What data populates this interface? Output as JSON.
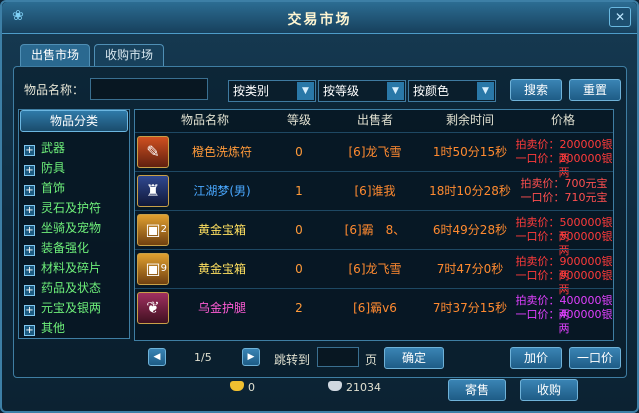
{
  "window": {
    "title": "交易市场"
  },
  "tabs": [
    {
      "label": "出售市场",
      "active": true
    },
    {
      "label": "收购市场",
      "active": false
    }
  ],
  "search": {
    "name_label": "物品名称：",
    "name_value": "",
    "type_select": "按类别",
    "level_select": "按等级",
    "color_select": "按颜色",
    "search_button": "搜索",
    "reset_button": "重置"
  },
  "categories": {
    "header": "物品分类",
    "items": [
      "武器",
      "防具",
      "首饰",
      "灵石及护符",
      "坐骑及宠物",
      "装备强化",
      "材料及碎片",
      "药品及状态",
      "元宝及银两",
      "其他"
    ]
  },
  "table": {
    "headers": [
      "物品名称",
      "等级",
      "出售者",
      "剩余时间",
      "价格"
    ],
    "rows": [
      {
        "icon": "scroll-icon",
        "name": "橙色洗炼符",
        "name_color": "#ff9a3a",
        "level": "0",
        "seller": "[6]龙飞雪",
        "time": "1时50分15秒",
        "price1": "拍卖价：200000银两",
        "price2": "一口价：200000银两",
        "price_color": "#ff3b3b",
        "qty": ""
      },
      {
        "icon": "armor-icon",
        "name": "江湖梦(男)",
        "name_color": "#4aa8ff",
        "level": "1",
        "seller": "[6]谁我",
        "time": "18时10分28秒",
        "price1": "拍卖价：700元宝",
        "price2": "一口价：710元宝",
        "price_color": "#ff4f4f",
        "qty": ""
      },
      {
        "icon": "treasure-chest-icon",
        "name": "黄金宝箱",
        "name_color": "#ffe060",
        "level": "0",
        "seller": "[6]霸　8、",
        "time": "6时49分28秒",
        "price1": "拍卖价：500000银两",
        "price2": "一口价：500000银两",
        "price_color": "#ff3b3b",
        "qty": "2"
      },
      {
        "icon": "treasure-chest-icon",
        "name": "黄金宝箱",
        "name_color": "#ffe060",
        "level": "0",
        "seller": "[6]龙飞雪",
        "time": "7时47分0秒",
        "price1": "拍卖价：900000银两",
        "price2": "一口价：900000银两",
        "price_color": "#ff3b3b",
        "qty": "9"
      },
      {
        "icon": "leg-armor-icon",
        "name": "乌金护腿",
        "name_color": "#ff5cd6",
        "level": "2",
        "seller": "[6]霸v6",
        "time": "7时37分15秒",
        "price1": "拍卖价：400000银两",
        "price2": "一口价：400000银两",
        "price_color": "#e040ff",
        "qty": ""
      }
    ]
  },
  "pager": {
    "page": "1/5",
    "jump_label": "跳转到",
    "jump_value": "",
    "page_unit": "页",
    "confirm_button": "确定",
    "raise_button": "加价",
    "buyout_button": "一口价"
  },
  "footer": {
    "gold": "0",
    "silver": "21034",
    "sell_button": "寄售",
    "buy_button": "收购"
  }
}
